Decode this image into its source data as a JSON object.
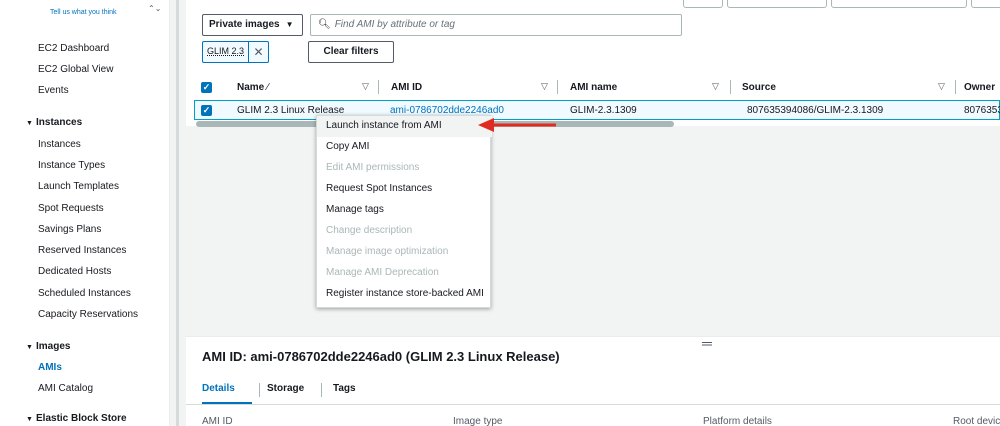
{
  "sidebar": {
    "feedback_link": "Tell us what you think",
    "top_items": [
      "EC2 Dashboard",
      "EC2 Global View",
      "Events"
    ],
    "sections": [
      {
        "heading": "Instances",
        "items": [
          "Instances",
          "Instance Types",
          "Launch Templates",
          "Spot Requests",
          "Savings Plans",
          "Reserved Instances",
          "Dedicated Hosts",
          "Scheduled Instances",
          "Capacity Reservations"
        ]
      },
      {
        "heading": "Images",
        "items": [
          "AMIs",
          "AMI Catalog"
        ],
        "active": "AMIs"
      },
      {
        "heading": "Elastic Block Store",
        "items": []
      }
    ]
  },
  "filters": {
    "ownership_select": "Private images",
    "search_placeholder": "Find AMI by attribute or tag",
    "active_token": "GLIM 2.3",
    "clear_label": "Clear filters"
  },
  "table": {
    "columns": [
      "Name",
      "AMI ID",
      "AMI name",
      "Source",
      "Owner"
    ],
    "rows": [
      {
        "name": "GLIM 2.3 Linux Release",
        "ami_id": "ami-0786702dde2246ad0",
        "ami_name": "GLIM-2.3.1309",
        "source": "807635394086/GLIM-2.3.1309",
        "owner": "8076353"
      }
    ]
  },
  "context_menu": {
    "items": [
      {
        "label": "Launch instance from AMI",
        "disabled": false,
        "highlighted": true
      },
      {
        "label": "Copy AMI",
        "disabled": false
      },
      {
        "label": "Edit AMI permissions",
        "disabled": true
      },
      {
        "label": "Request Spot Instances",
        "disabled": false
      },
      {
        "label": "Manage tags",
        "disabled": false
      },
      {
        "label": "Change description",
        "disabled": true
      },
      {
        "label": "Manage image optimization",
        "disabled": true
      },
      {
        "label": "Manage AMI Deprecation",
        "disabled": true
      },
      {
        "label": "Register instance store-backed AMI",
        "disabled": false
      }
    ]
  },
  "detail": {
    "title": "AMI ID: ami-0786702dde2246ad0 (GLIM 2.3 Linux Release)",
    "tabs": [
      "Details",
      "Storage",
      "Tags"
    ],
    "active_tab": "Details",
    "field_labels": [
      "AMI ID",
      "Image type",
      "Platform details",
      "Root devic"
    ]
  },
  "colors": {
    "accent": "#0073bb",
    "annotation_arrow": "#e02b20"
  }
}
